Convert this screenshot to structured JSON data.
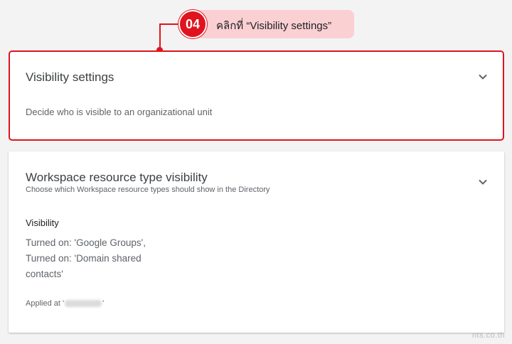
{
  "callout": {
    "step": "04",
    "instruction": "คลิกที่ “Visibility settings”"
  },
  "visibility_card": {
    "title": "Visibility settings",
    "description": "Decide who is visible to an organizational unit"
  },
  "resource_card": {
    "title": "Workspace resource type visibility",
    "description": "Choose which Workspace resource types should show in the Directory",
    "section_label": "Visibility",
    "status": "Turned on: 'Google Groups', Turned on: 'Domain shared contacts'",
    "applied_prefix": "Applied at '",
    "applied_suffix": "'"
  },
  "watermark": "nts.co.th",
  "colors": {
    "accent_red": "#e0141e",
    "callout_fill": "#fbd0d3"
  },
  "icons": {
    "expand": "chevron-down-icon"
  }
}
